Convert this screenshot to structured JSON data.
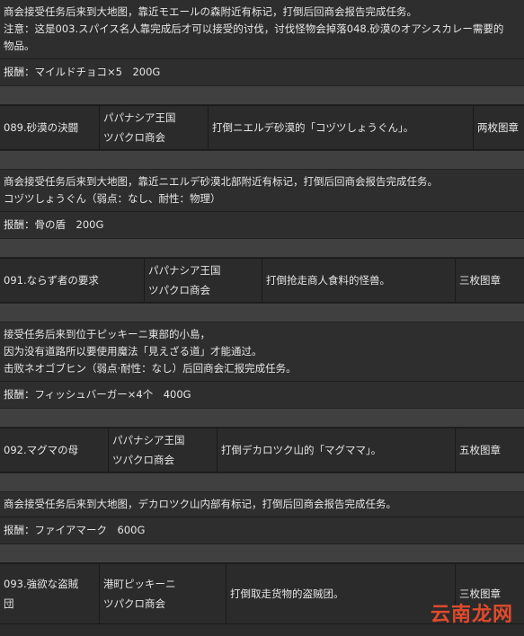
{
  "top": {
    "line1": "商会接受任务后来到大地图，靠近モエールの森附近有标记，打倒后回商会报告完成任务。",
    "line2": "注意：这是003.スパイス名人靠完成后才可以接受的讨伐，讨伐怪物会掉落048.砂漠のオアシスカレー需要的",
    "line3": "物品。",
    "reward": "报酬：マイルドチョコ×5　200G"
  },
  "quests": [
    {
      "title": "089.砂漠の決闘",
      "giver1": "パパナシア王国",
      "giver2": "ツパクロ商会",
      "task": "打倒ニエルデ砂漠的「コヅツしょうぐん」。",
      "prize": "两枚图章",
      "desc": [
        "商会接受任务后来到大地图，靠近ニエルデ砂漠北部附近有标记，打倒后回商会报告完成任务。",
        "コヅツしょうぐん（弱点：なし、耐性：物理）"
      ],
      "reward": "报酬：骨の盾　200G"
    },
    {
      "title": "091.ならず者の要求",
      "giver1": "パパナシア王国",
      "giver2": "ツパクロ商会",
      "task": "打倒抢走商人食料的怪兽。",
      "prize": "三枚图章",
      "desc": [
        "接受任务后来到位于ピッキーニ東部的小島，",
        "因为没有道路所以要使用魔法「見えざる道」才能通过。",
        "击败ネオゴブヒン（弱点·耐性：なし）后回商会汇报完成任务。"
      ],
      "reward": "报酬：フィッシュバーガー×4个　400G"
    },
    {
      "title": "092.マグマの母",
      "giver1": "パパナシア王国",
      "giver2": "ツパクロ商会",
      "task": "打倒デカロツク山的「マグママ」。",
      "prize": "五枚图章",
      "desc": [
        "商会接受任务后来到大地图，デカロツク山内部有标记，打倒后回商会报告完成任务。"
      ],
      "reward": "报酬：ファイアマーク　600G"
    },
    {
      "title_line1": "093.強欲な盗賊",
      "title_line2": "団",
      "giver1": "港町ピッキーニ",
      "giver2": "ツパクロ商会",
      "task": "打倒取走货物的盗贼团。",
      "prize": "三枚图章"
    }
  ],
  "watermark": "云南龙网"
}
